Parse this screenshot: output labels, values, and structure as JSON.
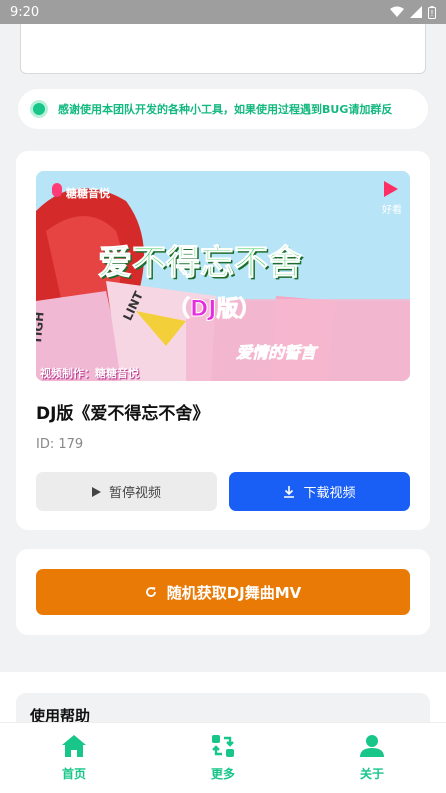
{
  "status_bar": {
    "time": "9:20"
  },
  "notice": {
    "text": "感谢使用本团队开发的各种小工具，如果使用过程遇到BUG请加群反"
  },
  "video": {
    "title": "DJ版《爱不得忘不舍》",
    "id_text": "ID: 179",
    "thumbnail": {
      "brand": "糖糖音悦",
      "corner_logo": "好看",
      "headline": "爱不得忘不舍",
      "subtitle": "（DJ版）",
      "signature": "爱情的誓言",
      "credit": "视频制作：糖糖音悦",
      "box_text_1": "TIGH",
      "box_text_2": "LINT"
    },
    "pause_label": "暂停视频",
    "download_label": "下载视频"
  },
  "random_button": {
    "label": "随机获取DJ舞曲MV"
  },
  "help": {
    "title": "使用帮助"
  },
  "tabs": [
    {
      "label": "首页",
      "icon": "home-icon"
    },
    {
      "label": "更多",
      "icon": "swap-icon"
    },
    {
      "label": "关于",
      "icon": "person-icon"
    }
  ],
  "colors": {
    "accent_green": "#19c68a",
    "download_blue": "#1a5ff5",
    "random_orange": "#e87a05"
  }
}
